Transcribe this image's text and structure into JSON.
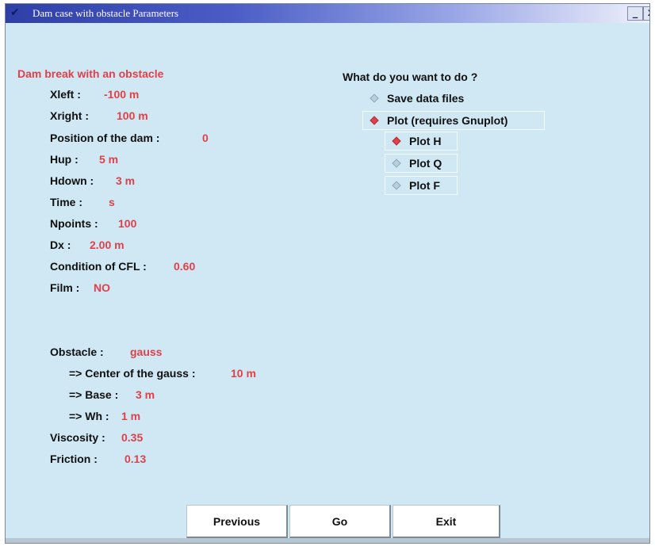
{
  "window": {
    "title": "Dam case with obstacle Parameters",
    "minimize_label": "_",
    "close_label": "x"
  },
  "params": {
    "heading": "Dam break with an obstacle",
    "xleft_label": "Xleft :",
    "xleft_value": "-100 m",
    "xright_label": "Xright :",
    "xright_value": "100 m",
    "dam_label": "Position of the dam :",
    "dam_value": "0",
    "hup_label": "Hup :",
    "hup_value": "5 m",
    "hdown_label": "Hdown :",
    "hdown_value": "3 m",
    "time_label": "Time :",
    "time_value": "s",
    "npoints_label": "Npoints :",
    "npoints_value": "100",
    "dx_label": "Dx :",
    "dx_value": "2.00 m",
    "cfl_label": "Condition of CFL :",
    "cfl_value": "0.60",
    "film_label": "Film :",
    "film_value": "NO",
    "obstacle_label": "Obstacle :",
    "obstacle_value": "gauss",
    "center_label": "=> Center of the gauss :",
    "center_value": "10 m",
    "base_label": "=> Base :",
    "base_value": "3 m",
    "wh_label": "=> Wh :",
    "wh_value": "1 m",
    "viscosity_label": "Viscosity :",
    "viscosity_value": "0.35",
    "friction_label": "Friction :",
    "friction_value": "0.13"
  },
  "actions": {
    "question": "What do you want to do ?",
    "options": [
      {
        "label": "Save data files",
        "selected": false
      },
      {
        "label": "Plot (requires Gnuplot)",
        "selected": true
      }
    ],
    "plot_options": [
      {
        "label": "Plot H",
        "selected": true
      },
      {
        "label": "Plot Q",
        "selected": false
      },
      {
        "label": "Plot F",
        "selected": false
      }
    ]
  },
  "buttons": {
    "previous": "Previous",
    "go": "Go",
    "exit": "Exit"
  },
  "colors": {
    "background": "#cfe8f3",
    "value_red": "#e0404a",
    "title_blue": "#2f3fa8"
  }
}
